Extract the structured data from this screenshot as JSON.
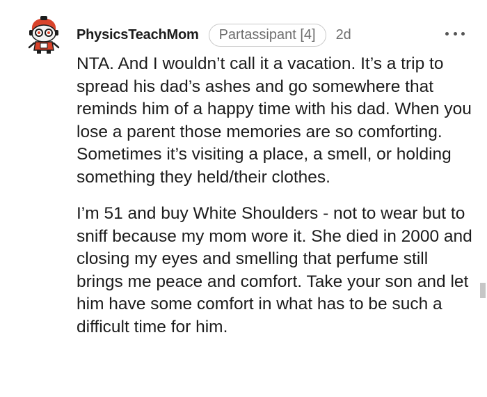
{
  "comment": {
    "author": "PhysicsTeachMom",
    "flair": "Partassipant [4]",
    "age": "2d",
    "avatar_icon": "snoo-avatar-icon",
    "more_icon": "more-options-icon",
    "paragraphs": [
      "NTA. And I wouldn’t call it a vacation. It’s a trip to spread his dad’s ashes and go somewhere that reminds him of a happy time with his dad. When you lose a parent those memories are so comforting. Sometimes it’s visiting a place, a smell, or holding something they held/their clothes.",
      "I’m 51 and buy White Shoulders - not to wear but to sniff because my mom wore it. She died in 2000 and closing my eyes and smelling that perfume still brings me peace and comfort. Take your son and let him have some comfort in what has to be such a difficult time for him."
    ]
  },
  "colors": {
    "text": "#1c1c1c",
    "meta": "#6e6e6e",
    "flair_border": "#c8c8c8",
    "avatar_red": "#d9432b"
  }
}
